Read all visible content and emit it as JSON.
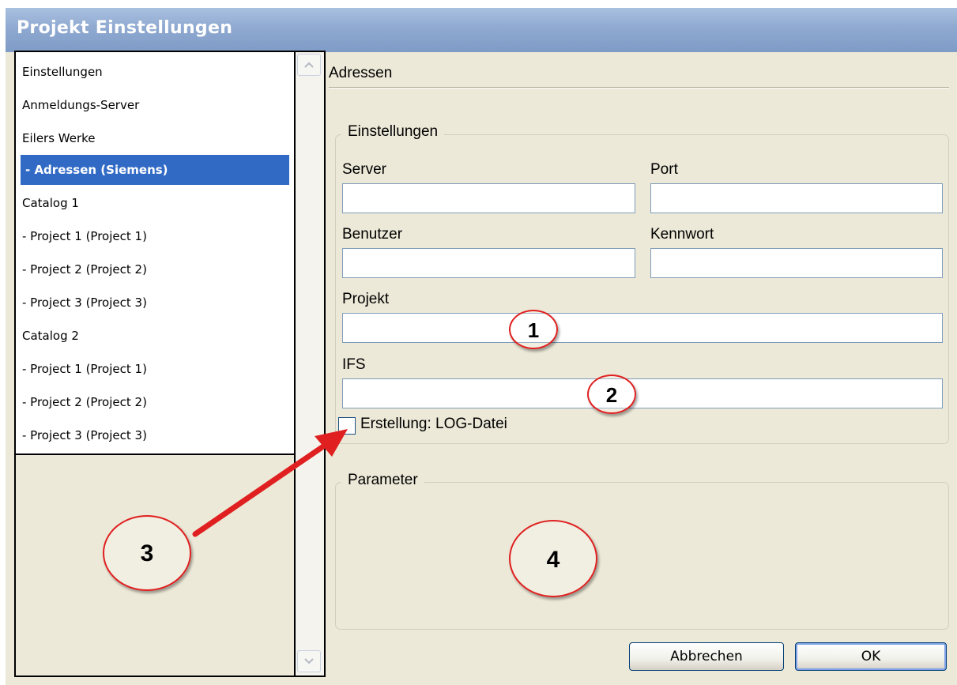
{
  "window": {
    "title": "Projekt Einstellungen"
  },
  "sidebar": {
    "items": [
      {
        "label": "Einstellungen"
      },
      {
        "label": "Anmeldungs-Server"
      },
      {
        "label": "Eilers Werke"
      },
      {
        "label": " - Adressen (Siemens)",
        "selected": true
      },
      {
        "label": "Catalog 1"
      },
      {
        "label": " - Project 1 (Project 1)"
      },
      {
        "label": " - Project 2 (Project 2)"
      },
      {
        "label": " - Project 3 (Project 3)"
      },
      {
        "label": "Catalog 2"
      },
      {
        "label": " - Project 1 (Project 1)"
      },
      {
        "label": " - Project 2 (Project 2)"
      },
      {
        "label": " - Project 3 (Project 3)"
      }
    ],
    "scroll_up_icon": "chevron-up-icon",
    "scroll_down_icon": "chevron-down-icon"
  },
  "main": {
    "heading": "Adressen",
    "settings_group": {
      "legend": "Einstellungen",
      "server_label": "Server",
      "server_value": "",
      "port_label": "Port",
      "port_value": "",
      "user_label": "Benutzer",
      "user_value": "",
      "password_label": "Kennwort",
      "password_value": "",
      "project_label": "Projekt",
      "project_value": "",
      "ifs_label": "IFS",
      "ifs_value": "",
      "log_checkbox_label": "Erstellung: LOG-Datei",
      "log_checked": false
    },
    "parameter_group": {
      "legend": "Parameter"
    }
  },
  "buttons": {
    "cancel_label": "Abbrechen",
    "ok_label": "OK"
  },
  "annotations": {
    "marker_1": "1",
    "marker_2": "2",
    "marker_3": "3",
    "marker_4": "4",
    "color": "#e02020"
  },
  "colors": {
    "selection": "#316ac5",
    "window_bg": "#ece9d8",
    "titlebar": "#8fa9d0"
  }
}
